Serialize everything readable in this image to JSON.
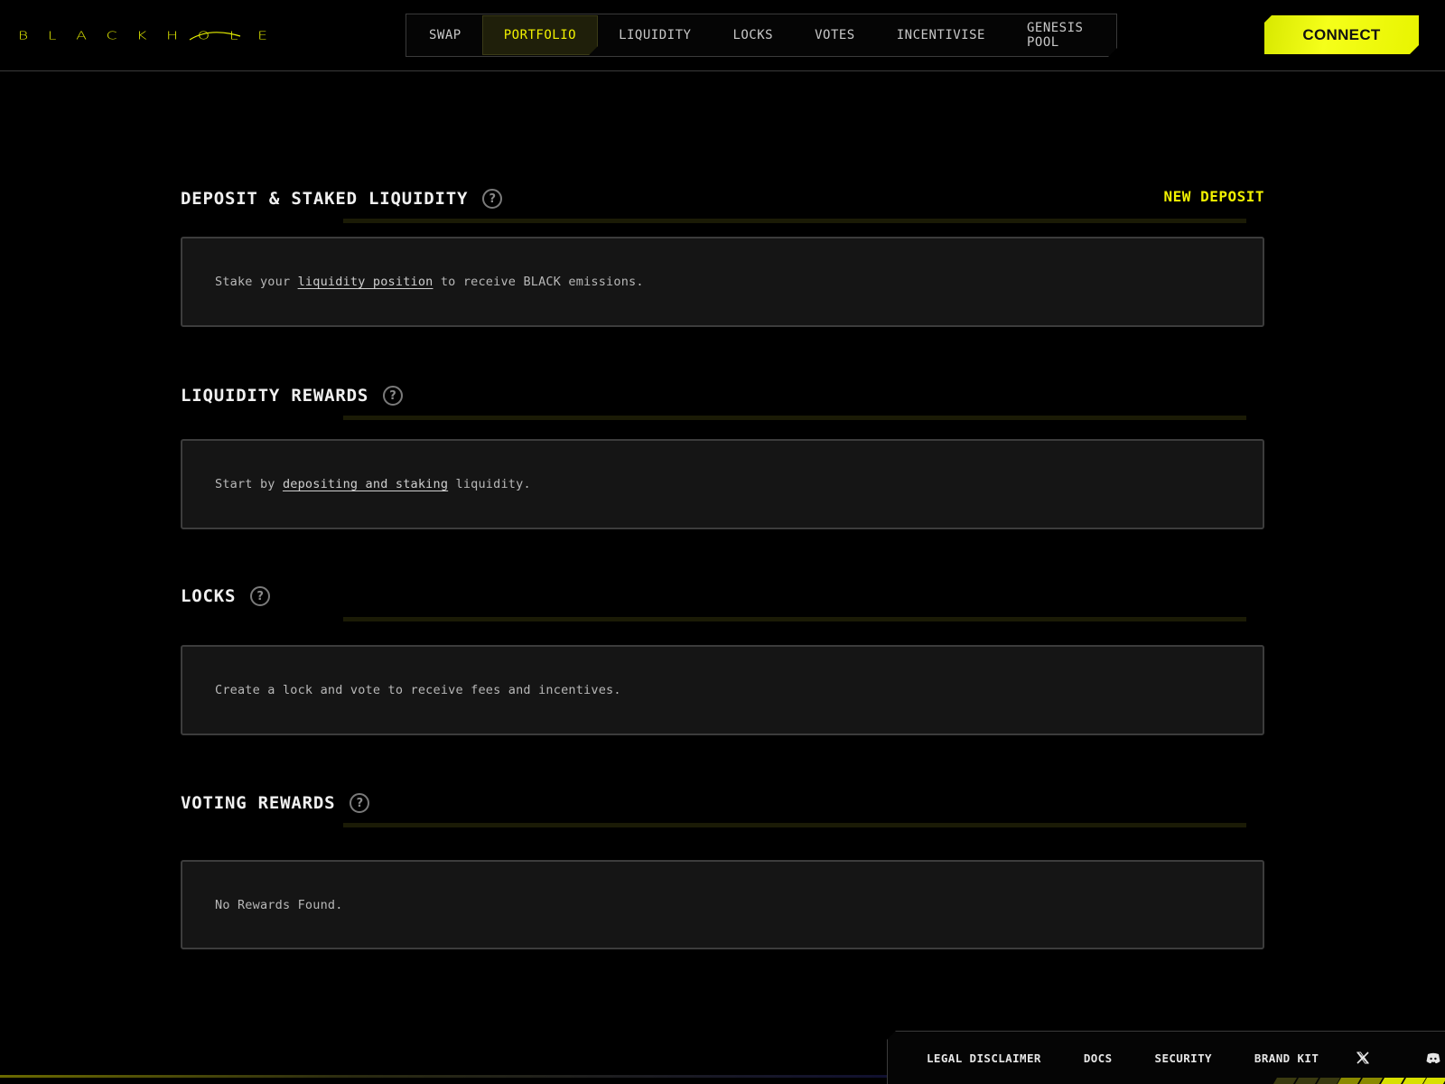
{
  "brand": {
    "letters": [
      "B",
      "L",
      "A",
      "C",
      "K",
      "H",
      "O",
      "L",
      "E"
    ],
    "accent_color": "#e8f000"
  },
  "nav": {
    "items": [
      {
        "label": "SWAP",
        "active": false
      },
      {
        "label": "PORTFOLIO",
        "active": true
      },
      {
        "label": "LIQUIDITY",
        "active": false
      },
      {
        "label": "LOCKS",
        "active": false
      },
      {
        "label": "VOTES",
        "active": false
      },
      {
        "label": "INCENTIVISE",
        "active": false
      },
      {
        "label": "GENESIS POOL",
        "active": false
      }
    ]
  },
  "header": {
    "connect_label": "CONNECT"
  },
  "sections": {
    "deposit": {
      "title": "DEPOSIT & STAKED LIQUIDITY",
      "action_label": "NEW DEPOSIT",
      "text_before": "Stake your ",
      "link": "liquidity position",
      "text_after": " to receive BLACK emissions."
    },
    "liquidity_rewards": {
      "title": "LIQUIDITY REWARDS",
      "text_before": "Start by ",
      "link": "depositing and staking",
      "text_after": " liquidity."
    },
    "locks": {
      "title": "LOCKS",
      "text": "Create a lock and vote to receive fees and incentives."
    },
    "voting_rewards": {
      "title": "VOTING REWARDS",
      "text": "No Rewards Found."
    }
  },
  "footer": {
    "links": [
      "LEGAL DISCLAIMER",
      "DOCS",
      "SECURITY",
      "BRAND KIT"
    ],
    "icons": [
      "x-icon",
      "discord-icon"
    ]
  }
}
